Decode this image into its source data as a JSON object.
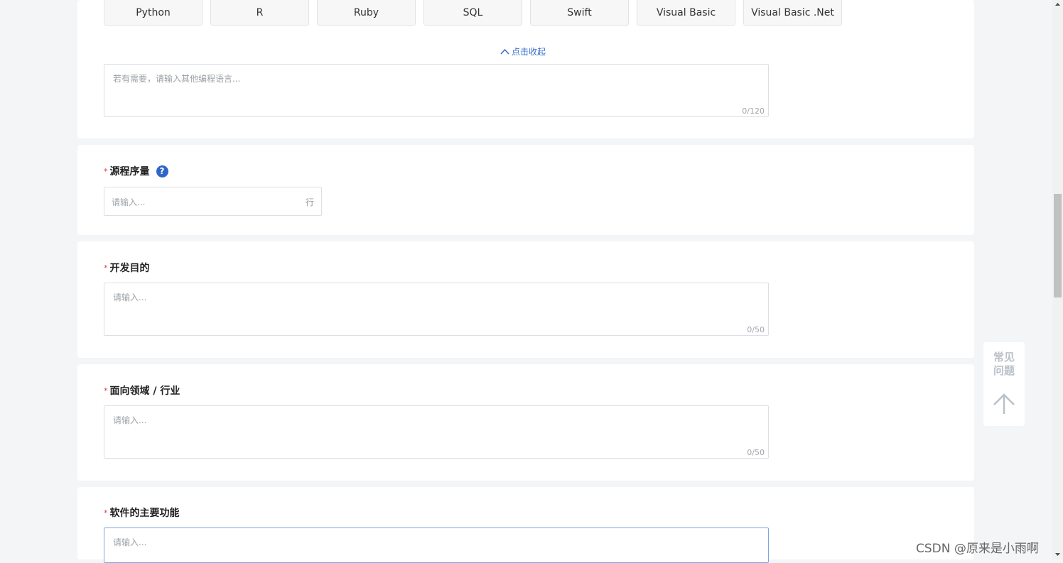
{
  "languages": [
    "Python",
    "R",
    "Ruby",
    "SQL",
    "Swift",
    "Visual Basic",
    "Visual Basic .Net"
  ],
  "collapse_label": "点击收起",
  "other_lang": {
    "placeholder": "若有需要，请输入其他编程语言...",
    "counter": "0/120"
  },
  "sections": {
    "source_lines": {
      "required_mark": "*",
      "label": "源程序量",
      "help": "?",
      "placeholder": "请输入...",
      "unit": "行"
    },
    "purpose": {
      "required_mark": "*",
      "label": "开发目的",
      "placeholder": "请输入...",
      "counter": "0/50"
    },
    "domain": {
      "required_mark": "*",
      "label": "面向领域 / 行业",
      "placeholder": "请输入...",
      "counter": "0/50"
    },
    "main_functions": {
      "required_mark": "*",
      "label": "软件的主要功能",
      "placeholder": "请输入..."
    }
  },
  "float_panel": {
    "line1": "常见",
    "line2": "问题"
  },
  "watermark": "CSDN @原来是小雨啊"
}
